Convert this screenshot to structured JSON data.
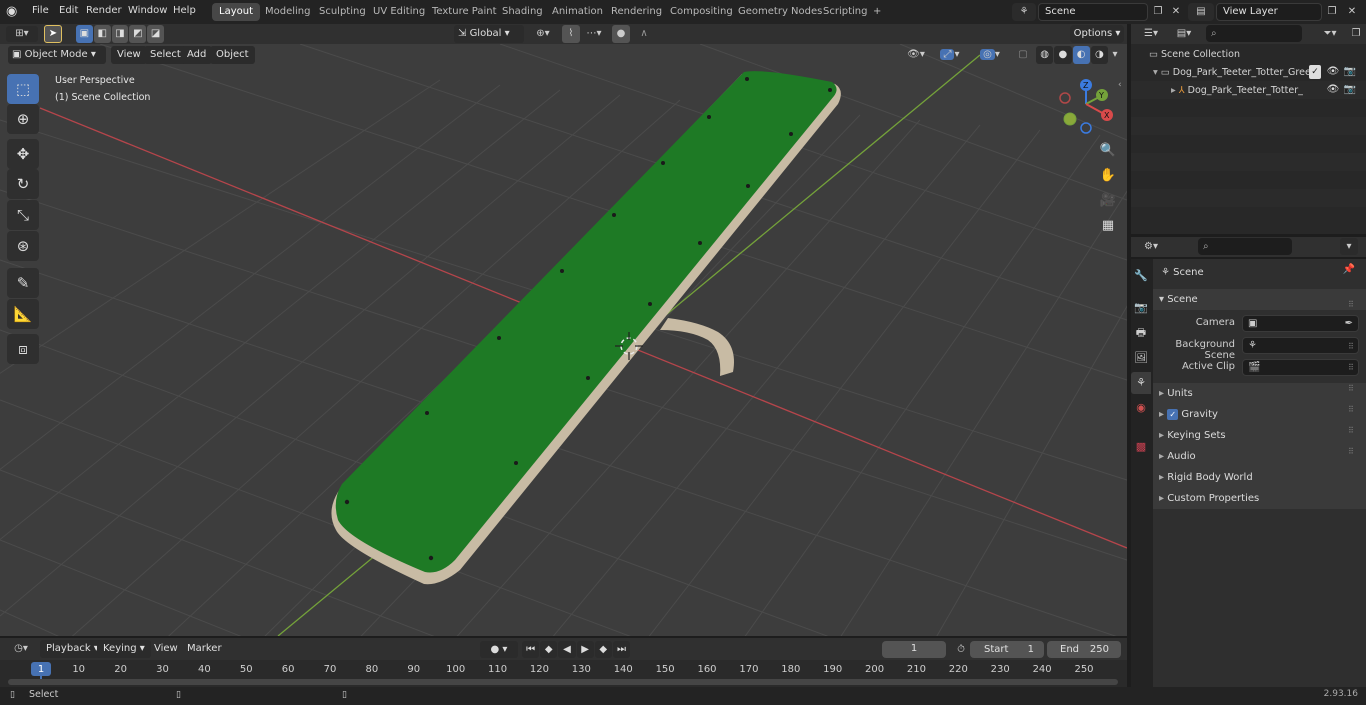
{
  "topbar": {
    "menus": [
      "File",
      "Edit",
      "Render",
      "Window",
      "Help"
    ],
    "workspaces": [
      "Layout",
      "Modeling",
      "Sculpting",
      "UV Editing",
      "Texture Paint",
      "Shading",
      "Animation",
      "Rendering",
      "Compositing",
      "Geometry Nodes",
      "Scripting"
    ],
    "active_workspace": "Layout",
    "add_tab": "+",
    "scene": "Scene",
    "view_layer": "View Layer"
  },
  "viewport_header": {
    "mode": "Object Mode",
    "menus": [
      "View",
      "Select",
      "Add",
      "Object"
    ],
    "transform": "Global",
    "options": "Options"
  },
  "viewport": {
    "perspective": "User Perspective",
    "collection": "(1) Scene Collection",
    "gizmo": {
      "z": "Z",
      "y": "Y",
      "x": "X"
    }
  },
  "outliner": {
    "root": "Scene Collection",
    "items": [
      "Dog_Park_Teeter_Totter_Gree",
      "Dog_Park_Teeter_Totter_"
    ]
  },
  "properties": {
    "breadcrumb": "Scene",
    "panel": "Scene",
    "camera_label": "Camera",
    "background_label": "Background Scene",
    "clip_label": "Active Clip",
    "sections": [
      "Units",
      "Gravity",
      "Keying Sets",
      "Audio",
      "Rigid Body World",
      "Custom Properties"
    ]
  },
  "timeline": {
    "menus": [
      "Playback",
      "Keying",
      "View",
      "Marker"
    ],
    "current_frame": "1",
    "start_label": "Start",
    "start": "1",
    "end_label": "End",
    "end": "250",
    "ticks": [
      "1",
      "10",
      "20",
      "30",
      "40",
      "50",
      "60",
      "70",
      "80",
      "90",
      "100",
      "110",
      "120",
      "130",
      "140",
      "150",
      "160",
      "170",
      "180",
      "190",
      "200",
      "210",
      "220",
      "230",
      "240",
      "250"
    ]
  },
  "status": {
    "select": "Select",
    "version": "2.93.16"
  },
  "colors": {
    "accent": "#4772b3",
    "board_green": "#1e7a25",
    "frame_beige": "#c8bba4",
    "x_axis": "#b5454b",
    "y_axis": "#74a23a"
  }
}
